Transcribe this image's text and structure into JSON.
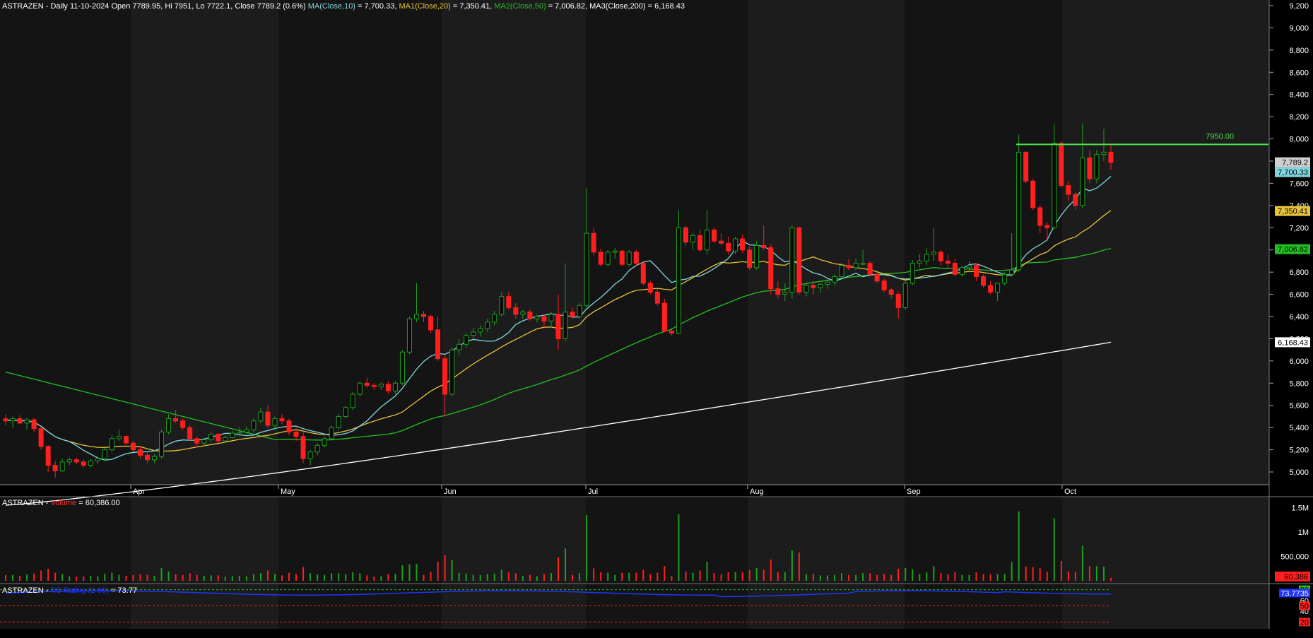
{
  "price_panel": {
    "header": {
      "ticker": "ASTRAZEN",
      "info": " - Daily 11-10-2024 Open 7789.95, Hi 7951, Lo 7722.1, Close 7789.2 (0.6%) ",
      "ma_label": "MA(Close,10)",
      "ma_value": " = 7,700.33, ",
      "ma1_label": "MA1(Close,20)",
      "ma1_value": " = 7,350.41, ",
      "ma2_label": "MA2(Close,50)",
      "ma2_value": " = 7,006.82, ",
      "ma3_label": "MA3(Close,200)",
      "ma3_value": " = 6,168.43"
    },
    "y_ticks": [
      "9,200",
      "9,000",
      "8,800",
      "8,600",
      "8,400",
      "8,200",
      "8,000",
      "7,800",
      "7,600",
      "7,400",
      "7,200",
      "7,000",
      "6,800",
      "6,600",
      "6,400",
      "6,200",
      "6,000",
      "5,800",
      "5,600",
      "5,400",
      "5,200",
      "5,000"
    ],
    "x_labels": [
      "Apr",
      "May",
      "Jun",
      "Jul",
      "Aug",
      "Sep",
      "Oct"
    ],
    "hline_label": "7950.00",
    "price_tags": {
      "close": "7,789.2",
      "ma10": "7,700.33",
      "ma20": "7,350.41",
      "ma50": "7,006.82",
      "ma200": "6,168.43"
    }
  },
  "volume_panel": {
    "ticker": "ASTRAZEN",
    "label": "Volume",
    "value": " = 60,386.00",
    "y_ticks": [
      "1.5M",
      "1M",
      "500,000"
    ],
    "last_tag": "60,386"
  },
  "rs_panel": {
    "ticker": "ASTRAZEN",
    "label": "RS Rating (1-99)",
    "value": " = 73.77",
    "y_ticks": [
      "80",
      "60",
      "40",
      "20"
    ],
    "value_tag": "73.7735",
    "tag_80": "80",
    "tag_50": "50",
    "tag_20": "20"
  },
  "colors": {
    "up": "#1ea01e",
    "down": "#ff1f1f",
    "ma10": "#7fd6de",
    "ma20": "#e8c23a",
    "ma50": "#22c022",
    "ma200": "#ffffff",
    "volume_label": "#ff3030",
    "rs_line": "#2233ff"
  },
  "chart_data": {
    "type": "candlestick",
    "title": "ASTRAZEN - Daily 11-10-2024",
    "ylim": [
      4850,
      9250
    ],
    "months": [
      "Apr",
      "May",
      "Jun",
      "Jul",
      "Aug",
      "Sep",
      "Oct"
    ],
    "series": [
      {
        "name": "Price",
        "values": [
          [
            5480,
            5520,
            5420,
            5460
          ],
          [
            5460,
            5500,
            5400,
            5480
          ],
          [
            5480,
            5510,
            5430,
            5440
          ],
          [
            5440,
            5490,
            5380,
            5470
          ],
          [
            5470,
            5490,
            5360,
            5390
          ],
          [
            5390,
            5400,
            5200,
            5230
          ],
          [
            5230,
            5240,
            5000,
            5060
          ],
          [
            5060,
            5100,
            4950,
            5010
          ],
          [
            5010,
            5120,
            5000,
            5090
          ],
          [
            5090,
            5130,
            5060,
            5110
          ],
          [
            5110,
            5130,
            5070,
            5090
          ],
          [
            5090,
            5110,
            5040,
            5060
          ],
          [
            5060,
            5120,
            5040,
            5100
          ],
          [
            5100,
            5140,
            5070,
            5120
          ],
          [
            5120,
            5220,
            5100,
            5200
          ],
          [
            5200,
            5330,
            5180,
            5300
          ],
          [
            5300,
            5380,
            5280,
            5320
          ],
          [
            5320,
            5330,
            5250,
            5260
          ],
          [
            5260,
            5280,
            5180,
            5200
          ],
          [
            5200,
            5230,
            5120,
            5150
          ],
          [
            5150,
            5180,
            5080,
            5110
          ],
          [
            5110,
            5160,
            5080,
            5140
          ],
          [
            5140,
            5380,
            5120,
            5360
          ],
          [
            5360,
            5520,
            5340,
            5480
          ],
          [
            5480,
            5560,
            5440,
            5460
          ],
          [
            5460,
            5480,
            5380,
            5400
          ],
          [
            5400,
            5420,
            5280,
            5300
          ],
          [
            5300,
            5320,
            5220,
            5260
          ],
          [
            5260,
            5310,
            5230,
            5290
          ],
          [
            5290,
            5360,
            5270,
            5340
          ],
          [
            5340,
            5350,
            5260,
            5280
          ],
          [
            5280,
            5330,
            5270,
            5310
          ],
          [
            5310,
            5370,
            5300,
            5350
          ],
          [
            5350,
            5400,
            5320,
            5360
          ],
          [
            5360,
            5410,
            5340,
            5380
          ],
          [
            5380,
            5480,
            5360,
            5460
          ],
          [
            5460,
            5580,
            5440,
            5540
          ],
          [
            5540,
            5600,
            5400,
            5420
          ],
          [
            5420,
            5500,
            5380,
            5480
          ],
          [
            5480,
            5520,
            5430,
            5460
          ],
          [
            5460,
            5480,
            5330,
            5360
          ],
          [
            5360,
            5400,
            5280,
            5320
          ],
          [
            5320,
            5360,
            5080,
            5120
          ],
          [
            5120,
            5200,
            5060,
            5180
          ],
          [
            5180,
            5260,
            5150,
            5240
          ],
          [
            5240,
            5320,
            5220,
            5300
          ],
          [
            5300,
            5420,
            5280,
            5400
          ],
          [
            5400,
            5520,
            5380,
            5500
          ],
          [
            5500,
            5600,
            5480,
            5580
          ],
          [
            5580,
            5720,
            5560,
            5700
          ],
          [
            5700,
            5820,
            5680,
            5800
          ],
          [
            5800,
            5850,
            5760,
            5780
          ],
          [
            5780,
            5800,
            5740,
            5770
          ],
          [
            5770,
            5810,
            5740,
            5790
          ],
          [
            5790,
            5820,
            5700,
            5730
          ],
          [
            5730,
            5820,
            5700,
            5800
          ],
          [
            5800,
            6100,
            5780,
            6080
          ],
          [
            6080,
            6400,
            6060,
            6380
          ],
          [
            6380,
            6700,
            6350,
            6420
          ],
          [
            6420,
            6450,
            6350,
            6400
          ],
          [
            6400,
            6420,
            6250,
            6280
          ],
          [
            6280,
            6400,
            6000,
            6020
          ],
          [
            6020,
            6050,
            5500,
            5700
          ],
          [
            5700,
            6120,
            5680,
            6100
          ],
          [
            6100,
            6200,
            6050,
            6150
          ],
          [
            6150,
            6250,
            6120,
            6230
          ],
          [
            6230,
            6300,
            6200,
            6260
          ],
          [
            6260,
            6320,
            6220,
            6290
          ],
          [
            6290,
            6380,
            6260,
            6350
          ],
          [
            6350,
            6450,
            6320,
            6420
          ],
          [
            6420,
            6620,
            6400,
            6580
          ],
          [
            6580,
            6620,
            6460,
            6480
          ],
          [
            6480,
            6520,
            6380,
            6420
          ],
          [
            6420,
            6460,
            6380,
            6440
          ],
          [
            6440,
            6460,
            6360,
            6380
          ],
          [
            6380,
            6420,
            6350,
            6400
          ],
          [
            6400,
            6420,
            6300,
            6360
          ],
          [
            6360,
            6440,
            6300,
            6420
          ],
          [
            6420,
            6600,
            6100,
            6200
          ],
          [
            6200,
            6880,
            6180,
            6440
          ],
          [
            6440,
            6480,
            6380,
            6400
          ],
          [
            6400,
            6520,
            6380,
            6500
          ],
          [
            6500,
            7560,
            6480,
            7150
          ],
          [
            7150,
            7200,
            6950,
            6980
          ],
          [
            6980,
            7010,
            6850,
            6870
          ],
          [
            6870,
            7000,
            6850,
            6980
          ],
          [
            6980,
            7020,
            6920,
            6990
          ],
          [
            6990,
            7000,
            6850,
            6870
          ],
          [
            6870,
            7000,
            6850,
            6980
          ],
          [
            6980,
            7000,
            6850,
            6880
          ],
          [
            6880,
            6900,
            6680,
            6700
          ],
          [
            6700,
            6720,
            6600,
            6620
          ],
          [
            6620,
            6650,
            6500,
            6520
          ],
          [
            6520,
            6560,
            6260,
            6270
          ],
          [
            6270,
            6300,
            6230,
            6250
          ],
          [
            6250,
            7360,
            6240,
            7200
          ],
          [
            7200,
            7220,
            7040,
            7070
          ],
          [
            7070,
            7150,
            7000,
            7130
          ],
          [
            7130,
            7180,
            6980,
            7000
          ],
          [
            7000,
            7360,
            6960,
            7180
          ],
          [
            7180,
            7200,
            7060,
            7080
          ],
          [
            7080,
            7150,
            7040,
            7060
          ],
          [
            7060,
            7120,
            6960,
            6990
          ],
          [
            6990,
            7120,
            6960,
            7100
          ],
          [
            7100,
            7140,
            6970,
            7000
          ],
          [
            7000,
            7030,
            6820,
            6840
          ],
          [
            6840,
            7080,
            6820,
            7040
          ],
          [
            7040,
            7220,
            7000,
            7020
          ],
          [
            7020,
            7050,
            6600,
            6650
          ],
          [
            6650,
            6720,
            6560,
            6600
          ],
          [
            6600,
            6700,
            6540,
            6620
          ],
          [
            6620,
            7220,
            6560,
            7200
          ],
          [
            7200,
            7210,
            6600,
            6620
          ],
          [
            6620,
            6700,
            6580,
            6680
          ],
          [
            6680,
            6720,
            6600,
            6660
          ],
          [
            6660,
            6700,
            6610,
            6690
          ],
          [
            6690,
            6740,
            6650,
            6710
          ],
          [
            6710,
            6780,
            6680,
            6760
          ],
          [
            6760,
            6880,
            6740,
            6860
          ],
          [
            6860,
            6920,
            6820,
            6840
          ],
          [
            6840,
            6920,
            6820,
            6880
          ],
          [
            6880,
            7000,
            6860,
            6880
          ],
          [
            6880,
            6900,
            6760,
            6780
          ],
          [
            6780,
            6800,
            6700,
            6720
          ],
          [
            6720,
            6740,
            6620,
            6640
          ],
          [
            6640,
            6660,
            6560,
            6600
          ],
          [
            6600,
            6620,
            6380,
            6480
          ],
          [
            6480,
            6720,
            6460,
            6700
          ],
          [
            6700,
            6910,
            6680,
            6880
          ],
          [
            6880,
            6960,
            6840,
            6900
          ],
          [
            6900,
            7020,
            6860,
            6960
          ],
          [
            6960,
            7200,
            6900,
            6980
          ],
          [
            6980,
            7000,
            6860,
            6900
          ],
          [
            6900,
            6960,
            6840,
            6880
          ],
          [
            6880,
            6920,
            6760,
            6780
          ],
          [
            6780,
            6860,
            6760,
            6840
          ],
          [
            6840,
            6900,
            6800,
            6860
          ],
          [
            6860,
            6880,
            6720,
            6760
          ],
          [
            6760,
            6780,
            6660,
            6680
          ],
          [
            6680,
            6720,
            6600,
            6620
          ],
          [
            6620,
            6660,
            6540,
            6700
          ],
          [
            6700,
            6800,
            6680,
            6780
          ],
          [
            6780,
            7150,
            6760,
            6820
          ],
          [
            6820,
            8040,
            6800,
            7880
          ],
          [
            7880,
            7890,
            7600,
            7620
          ],
          [
            7620,
            7640,
            7360,
            7380
          ],
          [
            7380,
            7400,
            7150,
            7220
          ],
          [
            7220,
            7250,
            7080,
            7200
          ],
          [
            7200,
            8140,
            7180,
            7960
          ],
          [
            7960,
            7980,
            7560,
            7580
          ],
          [
            7580,
            7620,
            7440,
            7500
          ],
          [
            7500,
            7520,
            7360,
            7400
          ],
          [
            7400,
            8140,
            7380,
            7830
          ],
          [
            7830,
            7900,
            7600,
            7640
          ],
          [
            7640,
            7900,
            7600,
            7860
          ],
          [
            7860,
            8090,
            7800,
            7880
          ],
          [
            7880,
            7951,
            7722,
            7789
          ]
        ]
      },
      {
        "name": "MA(Close,10)",
        "last": 7700.33
      },
      {
        "name": "MA1(Close,20)",
        "last": 7350.41
      },
      {
        "name": "MA2(Close,50)",
        "last": 7006.82
      },
      {
        "name": "MA3(Close,200)",
        "last": 6168.43
      }
    ],
    "horizontal_line": 7950,
    "volume_last": 60386,
    "rs_rating_last": 73.77
  }
}
